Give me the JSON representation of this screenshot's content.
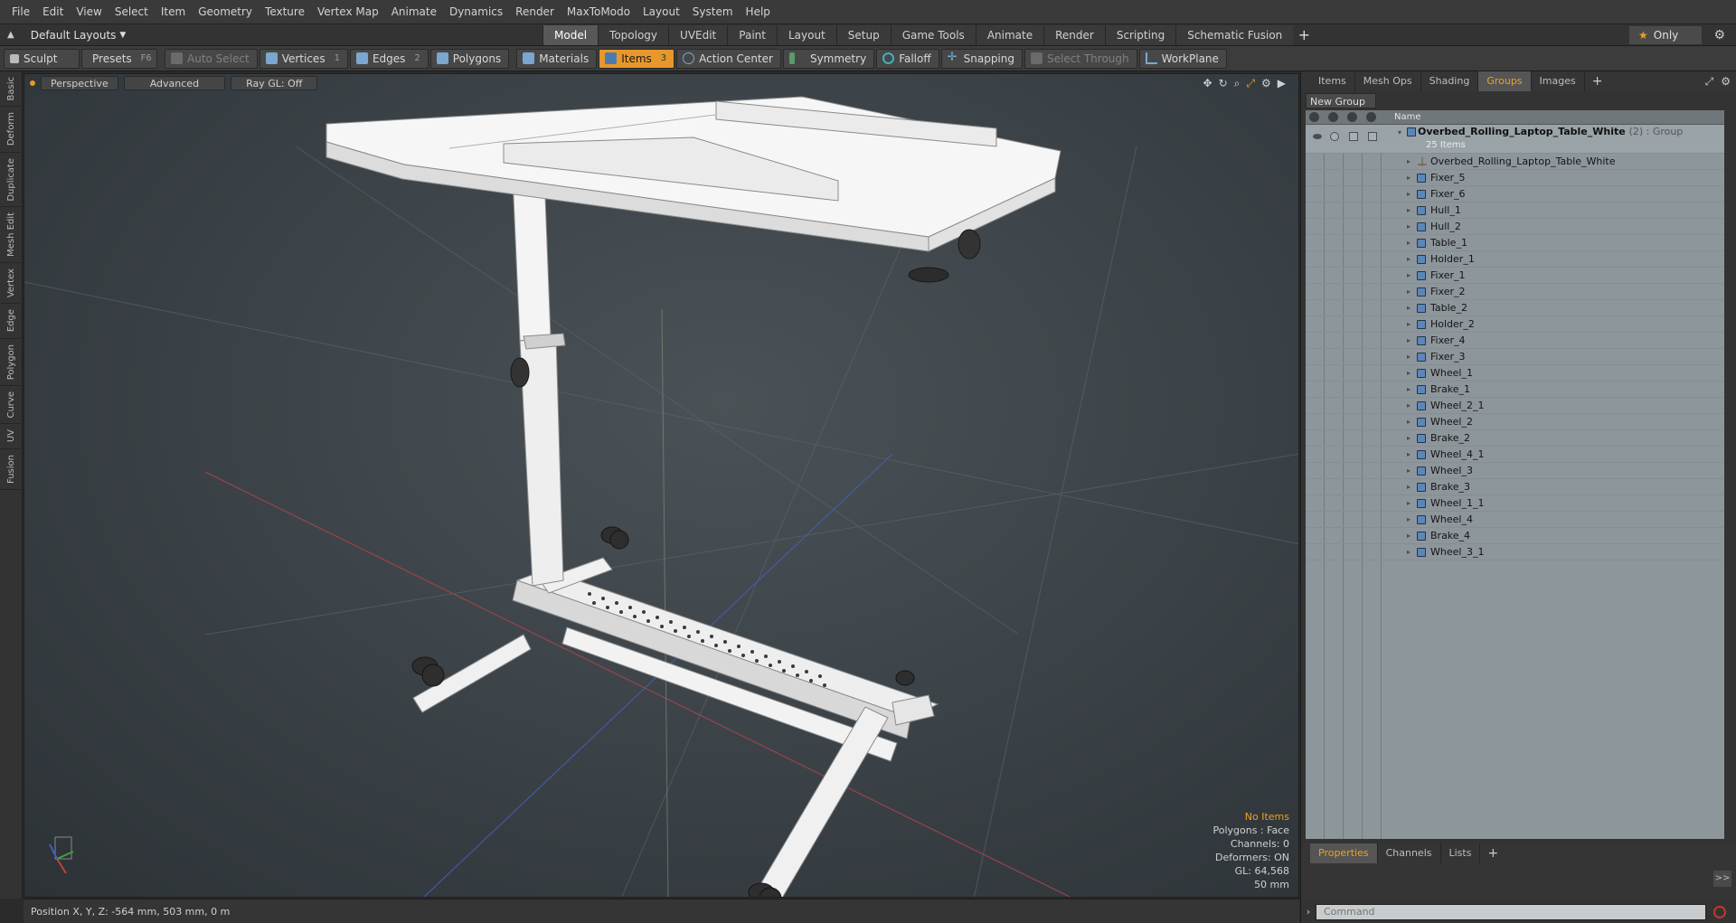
{
  "menubar": {
    "items": [
      "File",
      "Edit",
      "View",
      "Select",
      "Item",
      "Geometry",
      "Texture",
      "Vertex Map",
      "Animate",
      "Dynamics",
      "Render",
      "MaxToModo",
      "Layout",
      "System",
      "Help"
    ]
  },
  "layoutbar": {
    "layout_label": "Default Layouts",
    "tabs": [
      "Model",
      "Topology",
      "UVEdit",
      "Paint",
      "Layout",
      "Setup",
      "Game Tools",
      "Animate",
      "Render",
      "Scripting",
      "Schematic Fusion"
    ],
    "active_tab": "Model",
    "add_label": "+",
    "only_label": "Only"
  },
  "toolbar": {
    "sculpt": "Sculpt",
    "presets": "Presets",
    "presets_key": "F6",
    "auto_select": "Auto Select",
    "vertices": "Vertices",
    "vertices_count": "1",
    "edges": "Edges",
    "edges_count": "2",
    "polygons": "Polygons",
    "materials": "Materials",
    "items": "Items",
    "items_count": "3",
    "action_center": "Action Center",
    "symmetry": "Symmetry",
    "falloff": "Falloff",
    "snapping": "Snapping",
    "select_through": "Select Through",
    "workplane": "WorkPlane"
  },
  "lefttabs": [
    "Basic",
    "Deform",
    "Duplicate",
    "Mesh Edit",
    "Vertex",
    "Edge",
    "Polygon",
    "Curve",
    "UV",
    "Fusion"
  ],
  "viewport": {
    "view_mode": "Perspective",
    "shading": "Advanced",
    "raygl": "Ray GL: Off",
    "stats": {
      "selection": "No Items",
      "polygons": "Polygons : Face",
      "channels": "Channels: 0",
      "deformers": "Deformers: ON",
      "gl": "GL: 64,568",
      "unit": "50 mm"
    }
  },
  "statusbar": {
    "position": "Position X, Y, Z:  -564 mm, 503 mm, 0 m"
  },
  "panel": {
    "tabs": [
      "Items",
      "Mesh Ops",
      "Shading",
      "Groups",
      "Images"
    ],
    "active_tab": "Groups",
    "new_group": "New Group",
    "column_name": "Name",
    "group": {
      "name": "Overbed_Rolling_Laptop_Table_White",
      "suffix": "(2) : Group",
      "count": "25 Items"
    },
    "locator": "Overbed_Rolling_Laptop_Table_White",
    "items": [
      "Fixer_5",
      "Fixer_6",
      "Hull_1",
      "Hull_2",
      "Table_1",
      "Holder_1",
      "Fixer_1",
      "Fixer_2",
      "Table_2",
      "Holder_2",
      "Fixer_4",
      "Fixer_3",
      "Wheel_1",
      "Brake_1",
      "Wheel_2_1",
      "Wheel_2",
      "Brake_2",
      "Wheel_4_1",
      "Wheel_3",
      "Brake_3",
      "Wheel_1_1",
      "Wheel_4",
      "Brake_4",
      "Wheel_3_1"
    ]
  },
  "props": {
    "tabs": [
      "Properties",
      "Channels",
      "Lists"
    ],
    "active_tab": "Properties",
    "expand": ">>",
    "command_placeholder": "Command"
  },
  "colors": {
    "accent": "#f0a020",
    "active_tool": "#e8982a",
    "list_bg": "#8d969b",
    "viewport_bg": "#3a4146"
  }
}
